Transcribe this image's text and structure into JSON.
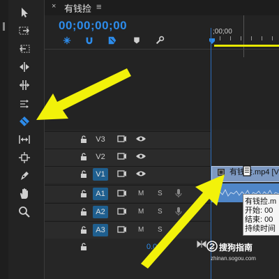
{
  "sequence_tab": {
    "close": "×",
    "title": "有钱捡",
    "menu": "≡"
  },
  "timecode": "00;00;00;00",
  "ruler": {
    "time_label": ";00;00"
  },
  "tracks": [
    {
      "id": "V3",
      "active": false,
      "type": "video"
    },
    {
      "id": "V2",
      "active": false,
      "type": "video"
    },
    {
      "id": "V1",
      "active": true,
      "type": "video"
    },
    {
      "id": "A1",
      "active": true,
      "type": "audio",
      "m": "M",
      "s": "S"
    },
    {
      "id": "A2",
      "active": true,
      "type": "audio",
      "m": "M",
      "s": "S"
    },
    {
      "id": "A3",
      "active": true,
      "type": "audio",
      "m": "M",
      "s": "S"
    }
  ],
  "master": {
    "value": "0.0"
  },
  "clip": {
    "label": "有钱捡.mp4 [V"
  },
  "tooltip": {
    "lines": [
      "有钱捡.m",
      "开始: 00",
      "结束: 00",
      "持续时间"
    ]
  },
  "watermark": {
    "main": "搜狗指南",
    "sub": "zhinan.sogou.com"
  },
  "tools": [
    "selection-tool",
    "track-select-forward-tool",
    "track-select-backward-tool",
    "ripple-edit-tool",
    "rolling-edit-tool",
    "rate-stretch-tool",
    "razor-tool",
    "slip-tool",
    "slide-tool",
    "pen-tool",
    "hand-tool",
    "zoom-tool"
  ],
  "colors": {
    "accent_blue": "#2d8ceb",
    "highlight_yellow": "#f2f20a",
    "track_active": "#1f5f8f"
  }
}
